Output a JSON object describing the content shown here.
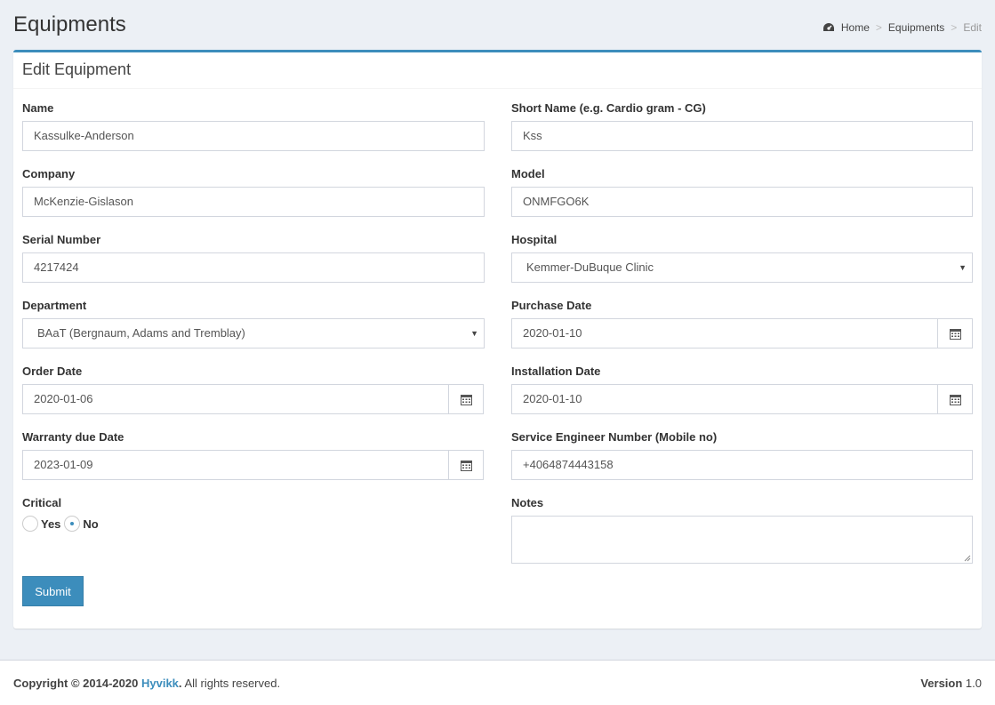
{
  "header": {
    "title": "Equipments",
    "breadcrumb": {
      "home": "Home",
      "section": "Equipments",
      "current": "Edit"
    }
  },
  "form": {
    "title": "Edit Equipment",
    "name": {
      "label": "Name",
      "value": "Kassulke-Anderson"
    },
    "short_name": {
      "label": "Short Name (e.g. Cardio gram - CG)",
      "value": "Kss"
    },
    "company": {
      "label": "Company",
      "value": "McKenzie-Gislason"
    },
    "model": {
      "label": "Model",
      "value": "ONMFGO6K"
    },
    "serial_number": {
      "label": "Serial Number",
      "value": "4217424"
    },
    "hospital": {
      "label": "Hospital",
      "value": "Kemmer-DuBuque Clinic"
    },
    "department": {
      "label": "Department",
      "value": "BAaT (Bergnaum, Adams and Tremblay)"
    },
    "purchase_date": {
      "label": "Purchase Date",
      "value": "2020-01-10"
    },
    "order_date": {
      "label": "Order Date",
      "value": "2020-01-06"
    },
    "installation_date": {
      "label": "Installation Date",
      "value": "2020-01-10"
    },
    "warranty_due_date": {
      "label": "Warranty due Date",
      "value": "2023-01-09"
    },
    "service_engineer_number": {
      "label": "Service Engineer Number (Mobile no)",
      "value": "+4064874443158"
    },
    "critical": {
      "label": "Critical",
      "yes_label": "Yes",
      "no_label": "No",
      "selected": "No"
    },
    "notes": {
      "label": "Notes",
      "value": ""
    },
    "submit_label": "Submit"
  },
  "footer": {
    "copyright_prefix": "Copyright © 2014-2020",
    "brand": "Hyvikk",
    "suffix": ". All rights reserved.",
    "version_label": "Version",
    "version": "1.0"
  },
  "colors": {
    "accent": "#3c8dbc",
    "background": "#ecf0f5"
  }
}
